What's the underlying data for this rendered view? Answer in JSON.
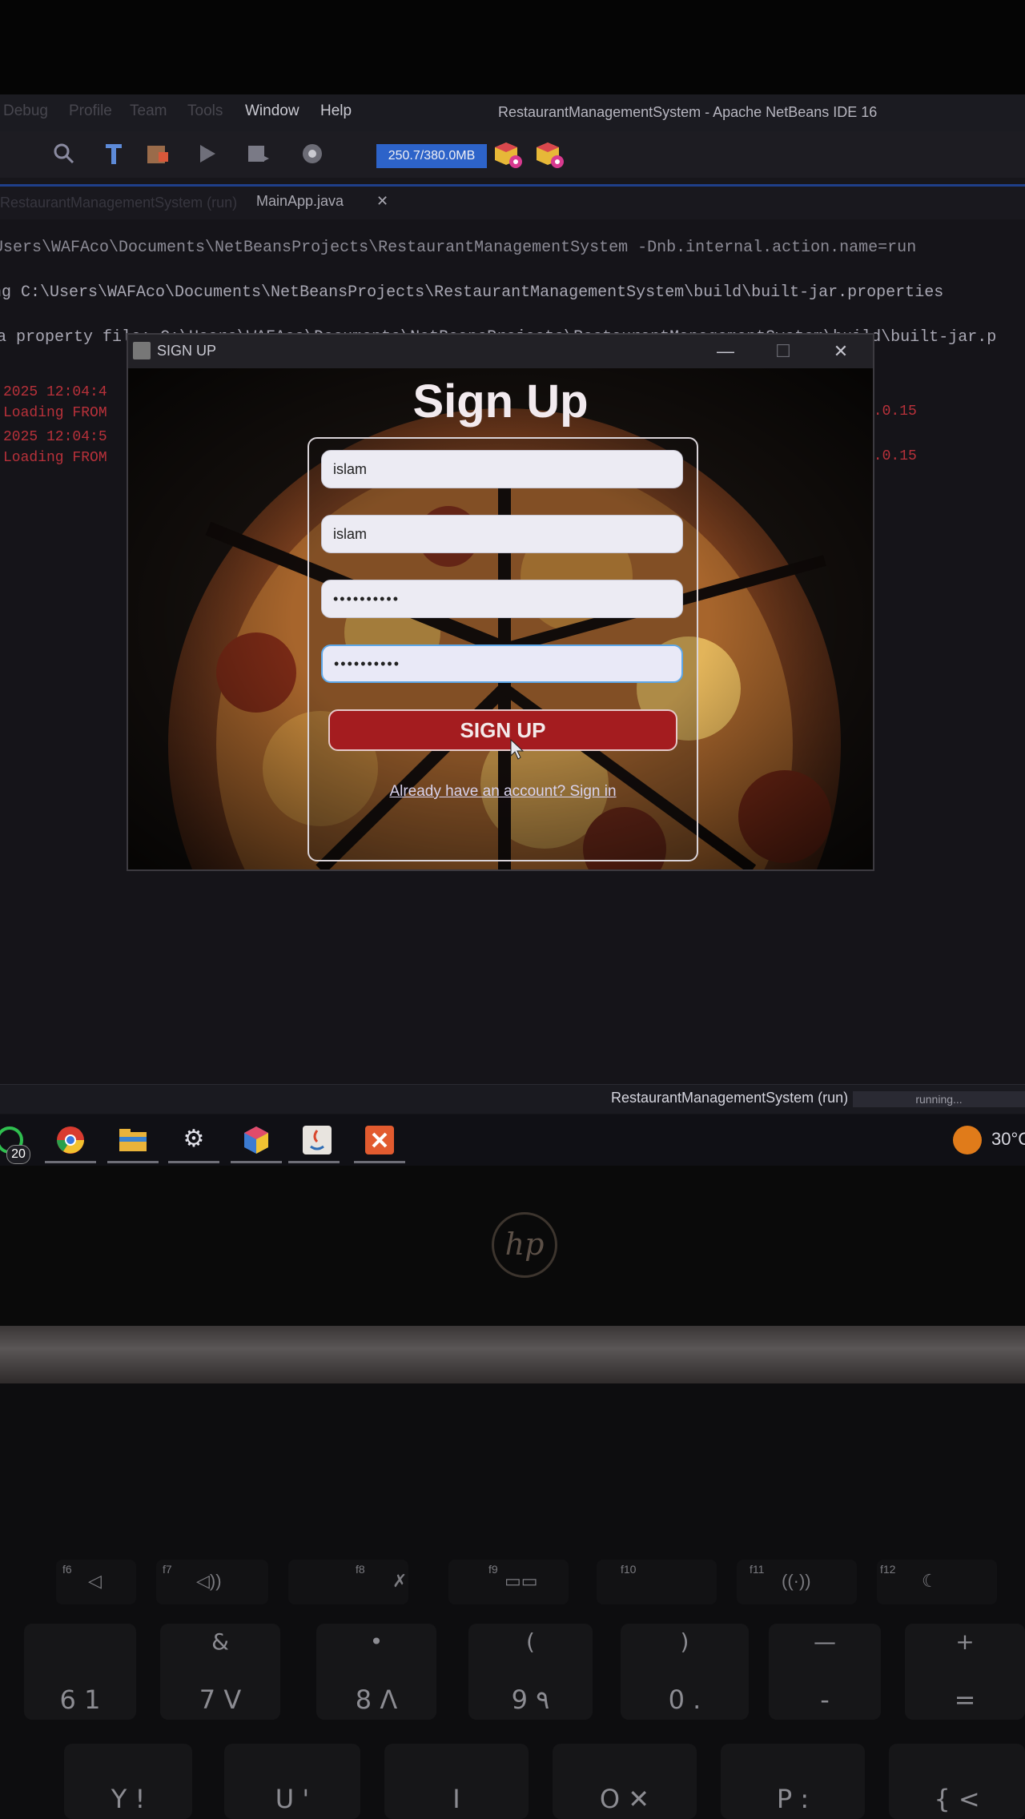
{
  "ide": {
    "menu": [
      "Debug",
      "Profile",
      "Team",
      "Tools",
      "Window",
      "Help"
    ],
    "title": "RestaurantManagementSystem - Apache NetBeans IDE 16",
    "memory": "250.7/380.0MB",
    "tabs": {
      "output_tab": "RestaurantManagementSystem (run)",
      "editor_tab": "MainApp.java",
      "close": "✕"
    },
    "console_lines": [
      "\\Users\\WAFAco\\Documents\\NetBeansProjects\\RestaurantManagementSystem -Dnb.internal.action.name=run",
      "ng C:\\Users\\WAFAco\\Documents\\NetBeansProjects\\RestaurantManagementSystem\\build\\built-jar.properties",
      "a property file: C:\\Users\\WAFAco\\Documents\\NetBeansProjects\\RestaurantManagementSystem\\build\\built-jar.p"
    ],
    "console_errors": [
      "2025 12:04:4",
      "Loading FROM",
      "2025 12:04:5",
      "Loading FROM"
    ],
    "console_error_tails": [
      "7.0.15",
      "7.0.15"
    ],
    "status": {
      "project": "RestaurantManagementSystem (run)",
      "progress": "running..."
    }
  },
  "window": {
    "title": "SIGN UP",
    "controls": {
      "minimize": "—",
      "maximize": "☐",
      "close": "✕"
    },
    "heading": "Sign Up",
    "fields": {
      "first": "islam",
      "second": "islam",
      "password": "••••••••••",
      "confirm_password": "••••••••••"
    },
    "signup_button": "SIGN UP",
    "signin_link": "Already have an account? Sign in"
  },
  "taskbar": {
    "whatsapp_badge": "20",
    "temperature": "30°C",
    "icons": [
      "whatsapp-icon",
      "chrome-icon",
      "file-explorer-icon",
      "settings-icon",
      "netbeans-icon",
      "java-icon",
      "xampp-icon"
    ]
  },
  "laptop": {
    "brand": "hp"
  },
  "keyboard": {
    "fkeys": [
      "f6",
      "f7",
      "f8",
      "f9",
      "f10",
      "f11",
      "f12"
    ],
    "row_numbers": [
      {
        "top": "",
        "bot": "6  1"
      },
      {
        "top": "&",
        "bot": "7  V"
      },
      {
        "top": "•",
        "bot": "8  Λ"
      },
      {
        "top": "(",
        "bot": "9  ٩"
      },
      {
        "top": ")",
        "bot": "0  ."
      },
      {
        "top": "—",
        "bot": "-"
      },
      {
        "top": "+",
        "bot": "="
      }
    ],
    "row_letters": [
      "Y  !",
      "U  '",
      "I",
      "O  ✕",
      "P  :",
      "{  <"
    ]
  },
  "colors": {
    "accent_red": "#a41c1f",
    "focus_blue": "#5da7e8",
    "memory_blue": "#2d63c9"
  }
}
